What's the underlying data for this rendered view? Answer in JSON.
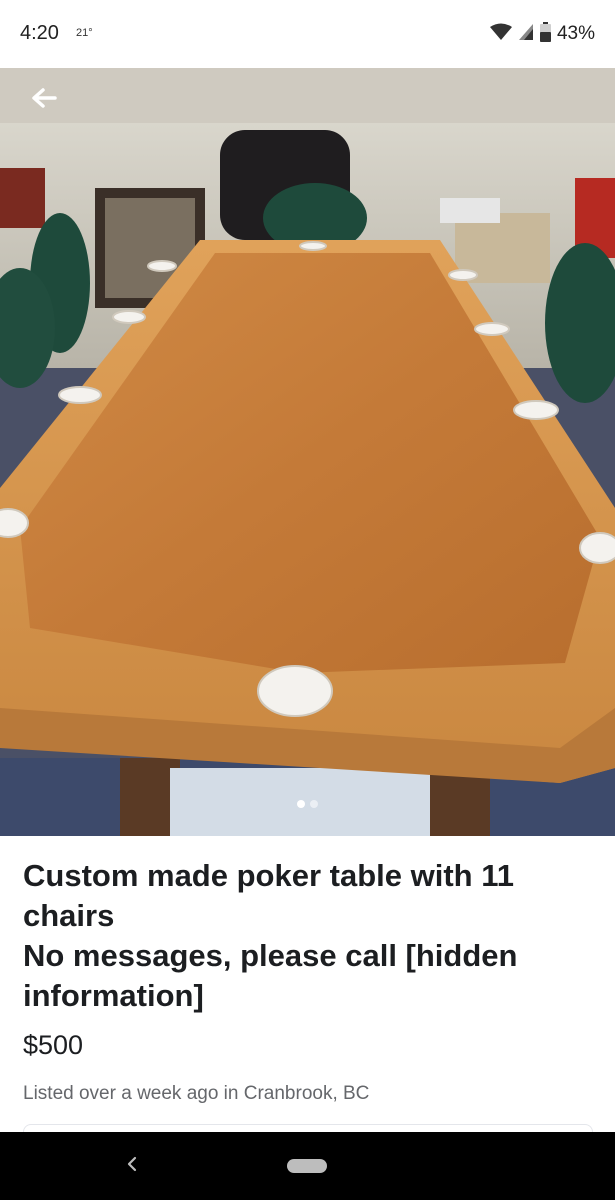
{
  "status_bar": {
    "time": "4:20",
    "temperature": "21°",
    "battery": "43%"
  },
  "photo": {
    "carousel_total": 2,
    "carousel_current": 1
  },
  "listing": {
    "title_line1": "Custom made poker table with 11",
    "title_line2": "chairs",
    "title_line3": "No messages, please call [hidden",
    "title_line4": "information]",
    "price": "$500",
    "meta": "Listed over a week ago in Cranbrook, BC"
  },
  "icons": {
    "back": "arrow-left-icon",
    "wifi": "wifi-icon",
    "signal": "cell-signal-icon",
    "battery": "battery-icon",
    "nav_back": "chevron-left-icon"
  },
  "colors": {
    "title_text": "#1c1e21",
    "meta_text": "#65676b",
    "nav_bar": "#000000"
  }
}
